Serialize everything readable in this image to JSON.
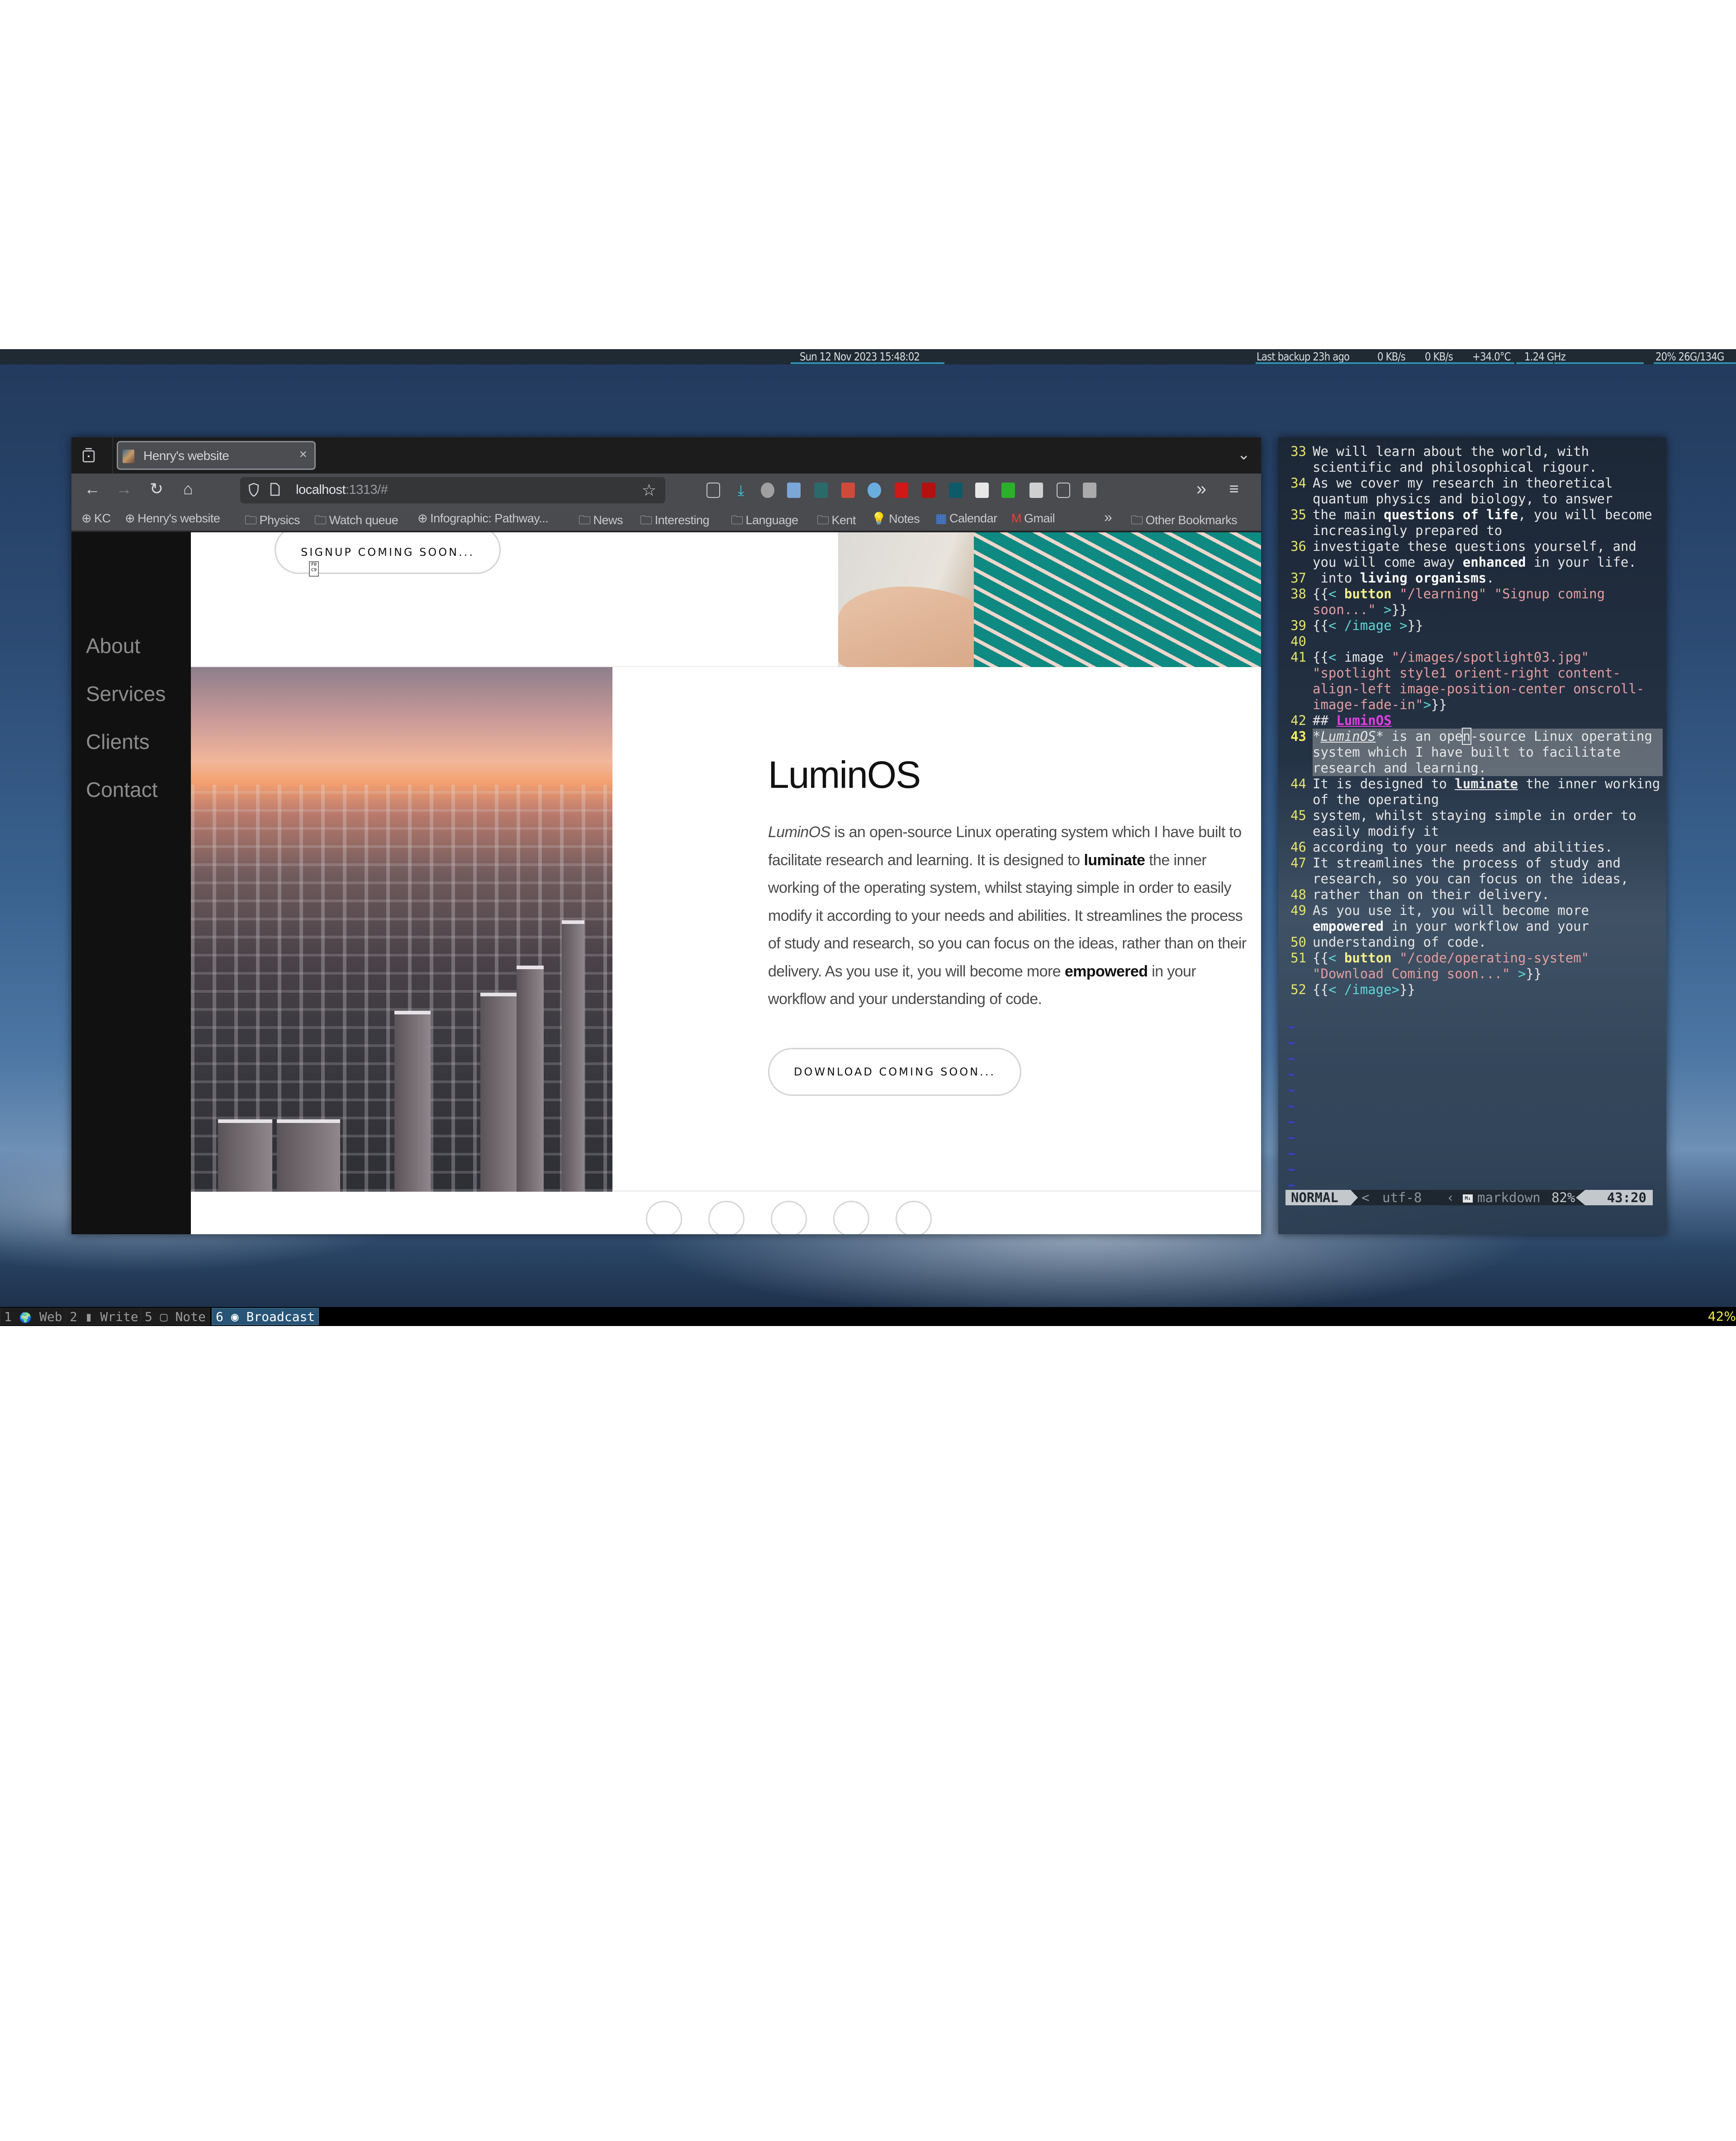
{
  "topbar": {
    "datetime": "Sun 12 Nov 2023 15:48:02",
    "backup": "Last backup 23h ago",
    "net_down": "0 KB/s",
    "net_up": "0 KB/s",
    "temperature": "+34.0°C",
    "cpu_freq": "1.24 GHz",
    "disk": "20% 26G/134G"
  },
  "browser": {
    "tab": {
      "title": "Henry's website",
      "close_glyph": "×"
    },
    "url": {
      "host": "localhost",
      "rest": ":1313/#"
    },
    "nav": {
      "back": "←",
      "forward": "→",
      "reload": "↻",
      "home": "⌂",
      "overflow": "»",
      "menu": "≡",
      "tab_overflow": "⌄",
      "star": "☆"
    },
    "extensions": [
      {
        "name": "pocket-icon",
        "color": "#4a4b4f"
      },
      {
        "name": "downloads-icon",
        "color": "#4a4b4f"
      },
      {
        "name": "h-extension-icon",
        "color": "#a0a0a0"
      },
      {
        "name": "documents-extension-icon",
        "color": "#7aa6d8"
      },
      {
        "name": "privacy-badger-icon",
        "color": "#2a6a6a"
      },
      {
        "name": "rocket-extension-icon",
        "color": "#d04a3a"
      },
      {
        "name": "v-extension-icon",
        "color": "#6aaee0"
      },
      {
        "name": "lock-extension-icon",
        "color": "#d01818"
      },
      {
        "name": "wand-extension-icon",
        "color": "#b41010"
      },
      {
        "name": "dark-teal-extension-icon",
        "color": "#0f5a68"
      },
      {
        "name": "reader-extension-icon",
        "color": "#e8e8e8"
      },
      {
        "name": "green-folder-extension-icon",
        "color": "#2bb02b"
      },
      {
        "name": "page-extension-icon",
        "color": "#cfcfcf"
      },
      {
        "name": "puzzle-extensions-icon",
        "color": "#4a4b4f"
      },
      {
        "name": "gray-extension-icon",
        "color": "#aaaaaa"
      }
    ],
    "bookmarks": [
      {
        "label": "KC",
        "icon": "globe"
      },
      {
        "label": "Henry's website",
        "icon": "globe"
      },
      {
        "label": "Physics",
        "icon": "folder"
      },
      {
        "label": "Watch queue",
        "icon": "folder"
      },
      {
        "label": "Infographic: Pathway...",
        "icon": "globe"
      },
      {
        "label": "News",
        "icon": "folder"
      },
      {
        "label": "Interesting",
        "icon": "folder"
      },
      {
        "label": "Language",
        "icon": "folder"
      },
      {
        "label": "Kent",
        "icon": "folder"
      },
      {
        "label": "Notes",
        "icon": "notes"
      },
      {
        "label": "Calendar",
        "icon": "calendar"
      },
      {
        "label": "Gmail",
        "icon": "gmail"
      }
    ],
    "bookmarks_overflow": "»",
    "other_bookmarks": "Other Bookmarks"
  },
  "site": {
    "nav": [
      "About",
      "Services",
      "Clients",
      "Contact"
    ],
    "signup_button": "SIGNUP COMING SOON...",
    "section_title": "LuminOS",
    "body": {
      "italic_lead": "LuminOS",
      "part1": " is an open-source Linux operating system which I have built to facilitate research and learning. It is designed to ",
      "bold1": "luminate",
      "part2": " the inner working of the operating system, whilst staying simple in order to easily modify it according to your needs and abilities. It streamlines the process of study and research, so you can focus on the ideas, rather than on their delivery. As you use it, you will become more ",
      "bold2": "empowered",
      "part3": " in your workflow and your understanding of code."
    },
    "download_button": "DOWNLOAD COMING SOON..."
  },
  "editor": {
    "lines": [
      {
        "n": "33",
        "parts": [
          [
            "t",
            "We will learn about the world, with scientific and philosophical rigour."
          ]
        ]
      },
      {
        "n": "34",
        "parts": [
          [
            "t",
            "As we cover my research in theoretical quantum physics and biology, to answer"
          ]
        ]
      },
      {
        "n": "35",
        "parts": [
          [
            "t",
            "the main "
          ],
          [
            "b",
            "questions of life"
          ],
          [
            "t",
            ", you will become increasingly prepared to"
          ]
        ]
      },
      {
        "n": "36",
        "parts": [
          [
            "t",
            "investigate these questions yourself, and you will come away "
          ],
          [
            "b",
            "enhanced"
          ],
          [
            "t",
            " in your life."
          ]
        ]
      },
      {
        "n": "37",
        "parts": [
          [
            "t",
            " into "
          ],
          [
            "b",
            "living organisms"
          ],
          [
            "t",
            "."
          ]
        ]
      },
      {
        "n": "38",
        "parts": [
          [
            "t",
            "{{"
          ],
          [
            "g",
            "<"
          ],
          [
            "t",
            " "
          ],
          [
            "k",
            "button"
          ],
          [
            "t",
            " "
          ],
          [
            "s",
            "\"/learning\" \"Signup coming soon...\""
          ],
          [
            "t",
            " "
          ],
          [
            "g",
            ">"
          ],
          [
            "t",
            "}}"
          ]
        ]
      },
      {
        "n": "39",
        "parts": [
          [
            "t",
            "{{"
          ],
          [
            "g",
            "< /image >"
          ],
          [
            "t",
            "}}"
          ]
        ]
      },
      {
        "n": "40",
        "parts": [
          [
            "t",
            ""
          ]
        ]
      },
      {
        "n": "41",
        "parts": [
          [
            "t",
            "{{"
          ],
          [
            "g",
            "<"
          ],
          [
            "t",
            " image "
          ],
          [
            "s",
            "\"/images/spotlight03.jpg\" \"spotlight style1 orient-right content-align-left image-position-center onscroll-image-fade-in\""
          ],
          [
            "g",
            ">"
          ],
          [
            "t",
            "}}"
          ]
        ]
      },
      {
        "n": "42",
        "parts": [
          [
            "t",
            "## "
          ],
          [
            "h",
            "LuminOS"
          ]
        ]
      },
      {
        "n": "43",
        "hl": true,
        "parts": [
          [
            "t",
            "*"
          ],
          [
            "i",
            "LuminOS"
          ],
          [
            "t",
            "* is an ope"
          ],
          [
            "c",
            "n"
          ],
          [
            "t",
            "-source Linux operating system which I have built to facilitate research and learning."
          ]
        ]
      },
      {
        "n": "44",
        "parts": [
          [
            "t",
            "It is designed to "
          ],
          [
            "u",
            "luminate"
          ],
          [
            "t",
            " the inner working of the operating"
          ]
        ]
      },
      {
        "n": "45",
        "parts": [
          [
            "t",
            "system, whilst staying simple in order to easily modify it"
          ]
        ]
      },
      {
        "n": "46",
        "parts": [
          [
            "t",
            "according to your needs and abilities."
          ]
        ]
      },
      {
        "n": "47",
        "parts": [
          [
            "t",
            "It streamlines the process of study and research, so you can focus on the ideas,"
          ]
        ]
      },
      {
        "n": "48",
        "parts": [
          [
            "t",
            "rather than on their delivery."
          ]
        ]
      },
      {
        "n": "49",
        "parts": [
          [
            "t",
            "As you use it, you will become more "
          ],
          [
            "b",
            "empowered"
          ],
          [
            "t",
            " in your workflow and your"
          ]
        ]
      },
      {
        "n": "50",
        "parts": [
          [
            "t",
            "understanding of code."
          ]
        ]
      },
      {
        "n": "51",
        "parts": [
          [
            "t",
            "{{"
          ],
          [
            "g",
            "<"
          ],
          [
            "t",
            " "
          ],
          [
            "k",
            "button"
          ],
          [
            "t",
            " "
          ],
          [
            "s",
            "\"/code/operating-system\" \"Download Coming soon...\""
          ],
          [
            "t",
            " "
          ],
          [
            "g",
            ">"
          ],
          [
            "t",
            "}}"
          ]
        ]
      },
      {
        "n": "52",
        "parts": [
          [
            "t",
            "{{"
          ],
          [
            "g",
            "< /image>"
          ],
          [
            "t",
            "}}"
          ]
        ]
      }
    ],
    "filler_glyph": "~",
    "status": {
      "mode": "NORMAL",
      "sep1": "<",
      "encoding": "utf-8",
      "sep2": "‹",
      "md_badge": "M↓",
      "filetype": "markdown",
      "percent": "82%",
      "position": "43:20"
    }
  },
  "workspaces": [
    {
      "num": "1",
      "icon": "🌍",
      "label": "Web",
      "active": false
    },
    {
      "num": "2",
      "icon": "▮",
      "label": "Write",
      "active": false
    },
    {
      "num": "5",
      "icon": "▢",
      "label": "Note",
      "active": false
    },
    {
      "num": "6",
      "icon": "◉",
      "label": "Broadcast",
      "active": true
    }
  ],
  "battery": "42%"
}
